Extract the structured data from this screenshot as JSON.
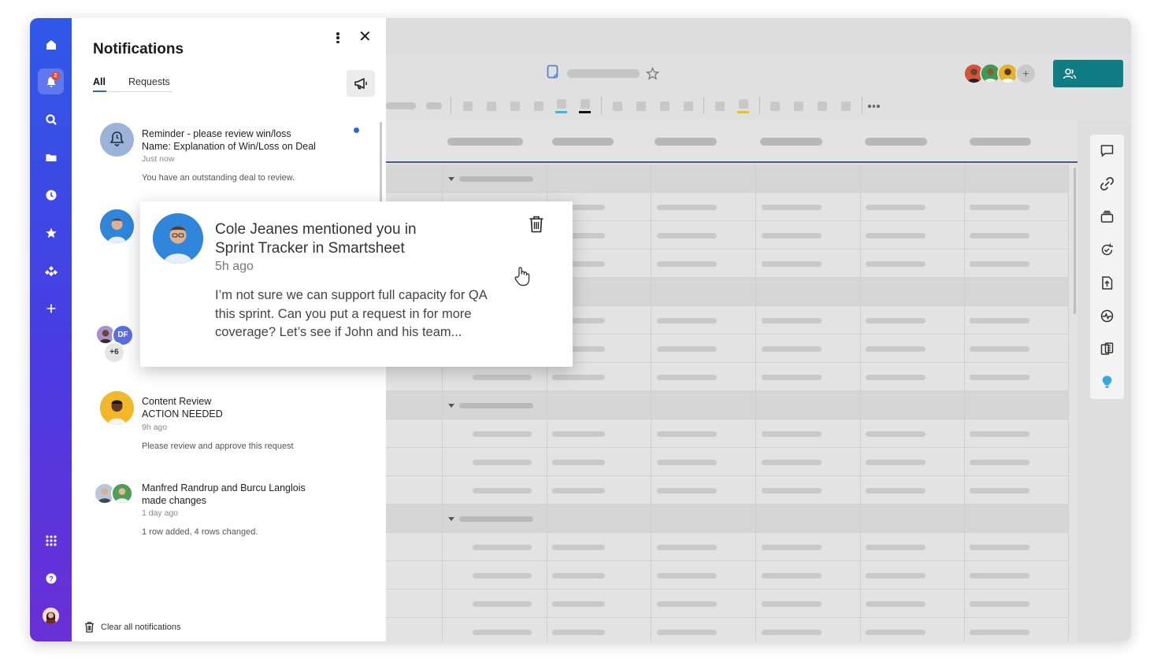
{
  "rail": {
    "items": [
      "home",
      "notifications",
      "search",
      "browse",
      "recents",
      "favorites",
      "solutions",
      "create"
    ],
    "notification_badge": "2",
    "bottom": [
      "launcher",
      "help",
      "account"
    ]
  },
  "panel": {
    "title": "Notifications",
    "tabs": [
      {
        "label": "All",
        "active": true
      },
      {
        "label": "Requests",
        "active": false
      }
    ],
    "notifications": [
      {
        "title_line1": "Reminder - please review win/loss",
        "title_line2": "Name: Explanation of Win/Loss on Deal",
        "time": "Just now",
        "body": "You have an outstanding deal to review.",
        "unread": true
      },
      {
        "group_count": "+6",
        "avatar_initials": "DF"
      },
      {
        "title_line1": "Content Review",
        "title_line2": "ACTION NEEDED",
        "time": "9h ago",
        "body": "Please review and approve this request"
      },
      {
        "title_line1": "Manfred Randrup and Burcu Langlois",
        "title_line2": "made changes",
        "time": "1 day ago",
        "body": "1 row added, 4 rows changed."
      }
    ],
    "clear_all": "Clear all notifications"
  },
  "popup": {
    "title_line1": "Cole Jeanes mentioned you in",
    "title_line2": "Sprint Tracker in Smartsheet",
    "time": "5h ago",
    "body_line1": "I’m not sure we can support full capacity for QA",
    "body_line2": "this sprint. Can you put a request in for more",
    "body_line3": "coverage? Let’s see if John and his team..."
  },
  "sheet": {
    "collaborators_more": "+",
    "share_icon": "share-users-icon",
    "right_rail_icons": [
      "comments-icon",
      "attachments-icon",
      "proofs-icon",
      "activity-log-icon",
      "publish-icon",
      "summary-icon",
      "forms-icon",
      "ideas-icon"
    ]
  },
  "colors": {
    "rail_top": "#2f59e8",
    "rail_bottom": "#6a2fd6",
    "accent_blue": "#2b66d9",
    "share_button": "#0f7d83",
    "badge_red": "#e24a3b"
  }
}
